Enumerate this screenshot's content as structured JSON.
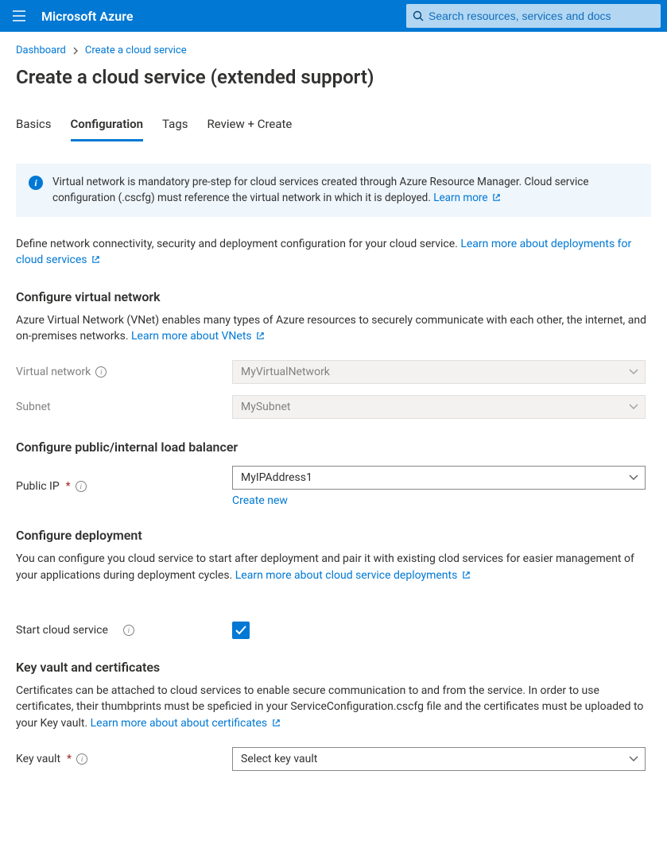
{
  "topbar": {
    "brand": "Microsoft Azure",
    "search_placeholder": "Search resources, services and docs"
  },
  "breadcrumb": {
    "items": [
      "Dashboard",
      "Create a cloud service"
    ]
  },
  "page": {
    "title": "Create a cloud service (extended support)"
  },
  "tabs": {
    "items": [
      {
        "label": "Basics",
        "active": false
      },
      {
        "label": "Configuration",
        "active": true
      },
      {
        "label": "Tags",
        "active": false
      },
      {
        "label": "Review + Create",
        "active": false
      }
    ]
  },
  "infobar": {
    "text": "Virtual network is mandatory pre-step for cloud services created through Azure Resource Manager. Cloud service configuration (.cscfg) must reference the virtual network in which it is deployed. ",
    "link": "Learn more"
  },
  "intro": {
    "text": "Define network connectivity, security and deployment configuration for your cloud service. ",
    "link": "Learn more about deployments for cloud services"
  },
  "vnet": {
    "heading": "Configure virtual network",
    "desc": "Azure Virtual Network (VNet) enables many types of Azure resources to securely communicate with each other, the internet, and on-premises networks. ",
    "desc_link": "Learn more about VNets",
    "network_label": "Virtual network",
    "network_value": "MyVirtualNetwork",
    "subnet_label": "Subnet",
    "subnet_value": "MySubnet"
  },
  "lb": {
    "heading": "Configure public/internal load balancer",
    "public_ip_label": "Public IP",
    "public_ip_value": "MyIPAddress1",
    "create_new": "Create new"
  },
  "deploy": {
    "heading": "Configure deployment",
    "desc": "You can configure you cloud service to start after deployment and pair it with existing clod services for easier management of your applications during deployment cycles. ",
    "desc_link": "Learn more about cloud service deployments",
    "start_label": "Start cloud service"
  },
  "kv": {
    "heading": "Key vault and certificates",
    "desc": "Certificates can be attached to cloud services to enable secure communication to and from the service. In order to use certificates, their thumbprints must be speficied in your ServiceConfiguration.cscfg file and the certificates must be uploaded to your Key vault. ",
    "desc_link": "Learn more about about certificates",
    "key_vault_label": "Key vault",
    "key_vault_value": "Select key vault"
  }
}
